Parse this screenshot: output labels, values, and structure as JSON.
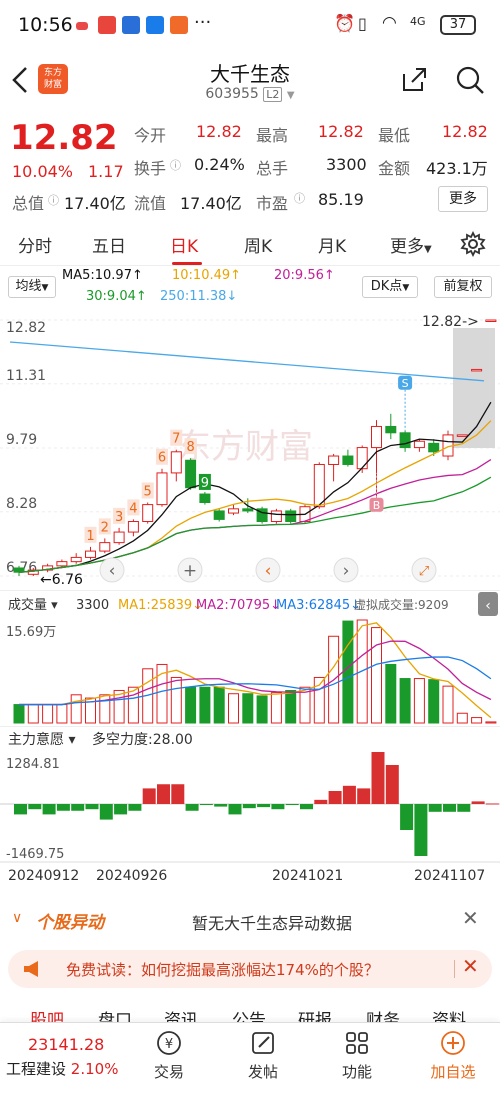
{
  "status_bar": {
    "time": "10:56",
    "battery": "37",
    "network": "4G"
  },
  "header": {
    "title": "大千生态",
    "code": "603955",
    "level": "L2",
    "logo_text_1": "东方",
    "logo_text_2": "财富"
  },
  "quote": {
    "price": "12.82",
    "change_pct": "10.04%",
    "change": "1.17",
    "open_label": "今开",
    "open": "12.82",
    "high_label": "最高",
    "high": "12.82",
    "low_label": "最低",
    "low": "12.82",
    "turnover_label": "换手",
    "turnover": "0.24%",
    "volume_label": "总手",
    "volume": "3300",
    "amount_label": "金额",
    "amount": "423.1万",
    "mcap_label": "总值",
    "mcap": "17.40亿",
    "float_label": "流值",
    "float": "17.40亿",
    "pe_label": "市盈",
    "pe": "85.19",
    "more": "更多"
  },
  "tabs": [
    "分时",
    "五日",
    "日K",
    "周K",
    "月K",
    "更多"
  ],
  "active_tab": "日K",
  "ma": {
    "selector": "均线",
    "ma5": "MA5:10.97",
    "ma10": "10:10.49",
    "ma20": "20:9.56",
    "ma30": "30:9.04",
    "ma250": "250:11.38",
    "dk": "DK点",
    "adjust": "前复权",
    "colors": {
      "ma5": "#111111",
      "ma10": "#e8a400",
      "ma20": "#c0209a",
      "ma30": "#1a9a2a",
      "ma250": "#4aa8e8"
    }
  },
  "kchart": {
    "y_labels": [
      "12.82",
      "11.31",
      "9.79",
      "8.28",
      "6.76"
    ],
    "last_label": "12.82->",
    "low_marker": "6.76",
    "watermark": "东方财富",
    "marker_s": "S",
    "marker_b": "B",
    "seq_labels": [
      "1",
      "2",
      "3",
      "4",
      "5",
      "6",
      "7",
      "8",
      "9"
    ]
  },
  "chart_data": {
    "type": "candlestick",
    "ylim": [
      6.76,
      12.82
    ],
    "candles": [
      {
        "o": 6.95,
        "c": 6.85,
        "h": 7.0,
        "l": 6.76
      },
      {
        "o": 6.8,
        "c": 6.9,
        "h": 6.95,
        "l": 6.76
      },
      {
        "o": 6.9,
        "c": 7.0,
        "h": 7.05,
        "l": 6.85
      },
      {
        "o": 7.0,
        "c": 7.1,
        "h": 7.15,
        "l": 6.95
      },
      {
        "o": 7.1,
        "c": 7.2,
        "h": 7.3,
        "l": 7.05
      },
      {
        "o": 7.2,
        "c": 7.35,
        "h": 7.45,
        "l": 7.15
      },
      {
        "o": 7.35,
        "c": 7.55,
        "h": 7.65,
        "l": 7.3
      },
      {
        "o": 7.55,
        "c": 7.8,
        "h": 7.9,
        "l": 7.5
      },
      {
        "o": 7.8,
        "c": 8.05,
        "h": 8.1,
        "l": 7.7
      },
      {
        "o": 8.05,
        "c": 8.45,
        "h": 8.5,
        "l": 8.0
      },
      {
        "o": 8.45,
        "c": 9.2,
        "h": 9.3,
        "l": 8.4
      },
      {
        "o": 9.2,
        "c": 9.7,
        "h": 9.75,
        "l": 9.0
      },
      {
        "o": 9.5,
        "c": 8.85,
        "h": 9.55,
        "l": 8.8
      },
      {
        "o": 8.7,
        "c": 8.5,
        "h": 8.75,
        "l": 8.45
      },
      {
        "o": 8.3,
        "c": 8.1,
        "h": 8.35,
        "l": 8.05
      },
      {
        "o": 8.25,
        "c": 8.35,
        "h": 8.45,
        "l": 8.2
      },
      {
        "o": 8.35,
        "c": 8.3,
        "h": 8.6,
        "l": 8.25
      },
      {
        "o": 8.35,
        "c": 8.05,
        "h": 8.4,
        "l": 8.0
      },
      {
        "o": 8.05,
        "c": 8.3,
        "h": 8.35,
        "l": 8.0
      },
      {
        "o": 8.3,
        "c": 8.05,
        "h": 8.35,
        "l": 8.0
      },
      {
        "o": 8.05,
        "c": 8.4,
        "h": 8.45,
        "l": 8.0
      },
      {
        "o": 8.4,
        "c": 9.4,
        "h": 9.45,
        "l": 8.35
      },
      {
        "o": 9.4,
        "c": 9.6,
        "h": 9.65,
        "l": 9.0
      },
      {
        "o": 9.6,
        "c": 9.4,
        "h": 9.75,
        "l": 9.35
      },
      {
        "o": 9.3,
        "c": 9.8,
        "h": 9.85,
        "l": 9.2
      },
      {
        "o": 9.8,
        "c": 10.3,
        "h": 10.45,
        "l": 8.4
      },
      {
        "o": 10.3,
        "c": 10.15,
        "h": 10.6,
        "l": 10.0
      },
      {
        "o": 10.15,
        "c": 9.8,
        "h": 10.2,
        "l": 9.7
      },
      {
        "o": 9.8,
        "c": 9.95,
        "h": 10.0,
        "l": 9.7
      },
      {
        "o": 9.9,
        "c": 9.7,
        "h": 10.0,
        "l": 9.6
      },
      {
        "o": 9.6,
        "c": 10.1,
        "h": 10.2,
        "l": 9.5
      },
      {
        "o": 10.1,
        "c": 10.1,
        "h": 10.1,
        "l": 10.1
      },
      {
        "o": 11.65,
        "c": 11.65,
        "h": 11.65,
        "l": 11.65
      },
      {
        "o": 12.82,
        "c": 12.82,
        "h": 12.82,
        "l": 12.82
      }
    ],
    "volume": [
      17,
      17,
      17,
      17,
      26,
      23,
      26,
      30,
      33,
      50,
      54,
      42,
      33,
      33,
      33,
      27,
      27,
      25,
      28,
      30,
      33,
      42,
      80,
      94,
      95,
      88,
      54,
      41,
      41,
      40,
      34,
      9,
      5,
      1
    ],
    "sentiment": [
      -20,
      -10,
      -20,
      -13,
      -13,
      -10,
      -30,
      -20,
      -13,
      30,
      38,
      38,
      -13,
      -2,
      -5,
      -20,
      -8,
      -6,
      -10,
      -2,
      -10,
      8,
      25,
      35,
      30,
      100,
      75,
      -50,
      -100,
      -15,
      -15,
      -15,
      5,
      1
    ]
  },
  "vol_panel": {
    "label": "成交量",
    "value": "3300",
    "ma1": "MA1:25839",
    "ma2": "MA2:70795",
    "ma3": "MA3:62845",
    "virtual": "虚拟成交量:9209",
    "top": "15.69万"
  },
  "ind_panel": {
    "label": "主力意愿",
    "value": "多空力度:28.00",
    "top": "1284.81",
    "bottom": "-1469.75",
    "dates": [
      "20240912",
      "20240926",
      "20241021",
      "20241107"
    ]
  },
  "alert": {
    "title": "个股异动",
    "text": "暂无大千生态异动数据"
  },
  "promo": {
    "text": "免费试读：如何挖掘最高涨幅达174%的个股？"
  },
  "subtabs": [
    "股吧",
    "盘口",
    "资讯",
    "公告",
    "研报",
    "财务",
    "资料"
  ],
  "bottom_bar": {
    "index_value": "23141.28",
    "index_name": "工程建设",
    "index_change": "2.10%",
    "items": [
      "交易",
      "发帖",
      "功能",
      "加自选"
    ]
  }
}
